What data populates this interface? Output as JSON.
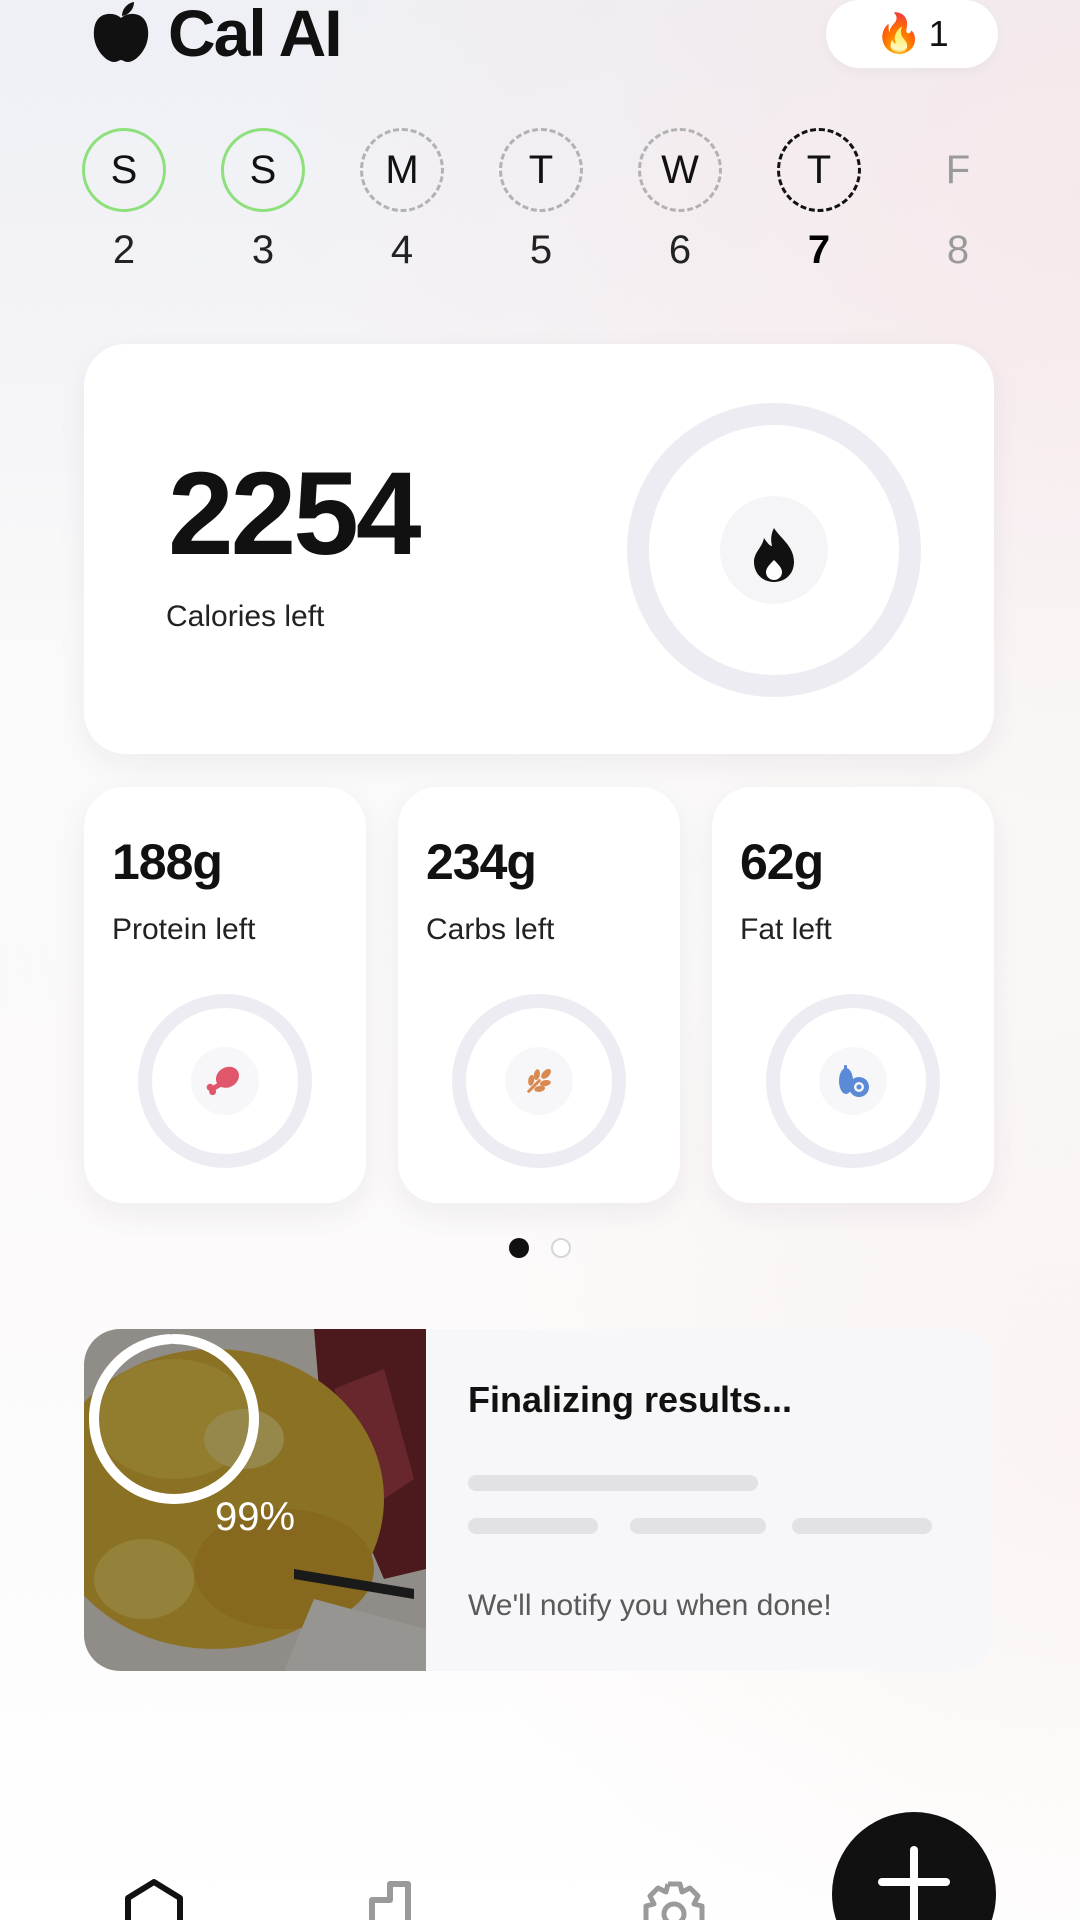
{
  "app": {
    "title": "Cal AI",
    "streak_count": "1"
  },
  "week": [
    {
      "letter": "S",
      "date": "2",
      "state": "done"
    },
    {
      "letter": "S",
      "date": "3",
      "state": "done"
    },
    {
      "letter": "M",
      "date": "4",
      "state": "missed"
    },
    {
      "letter": "T",
      "date": "5",
      "state": "missed"
    },
    {
      "letter": "W",
      "date": "6",
      "state": "missed"
    },
    {
      "letter": "T",
      "date": "7",
      "state": "today"
    },
    {
      "letter": "F",
      "date": "8",
      "state": "future"
    }
  ],
  "calories": {
    "value": "2254",
    "label": "Calories left",
    "progress": 0
  },
  "macros": [
    {
      "value": "188g",
      "label": "Protein left",
      "icon": "drumstick-icon",
      "color": "#e0566a",
      "progress": 0
    },
    {
      "value": "234g",
      "label": "Carbs left",
      "icon": "wheat-icon",
      "color": "#d98a52",
      "progress": 0
    },
    {
      "value": "62g",
      "label": "Fat left",
      "icon": "avocado-icon",
      "color": "#5b8ad6",
      "progress": 0
    }
  ],
  "pager": {
    "pages": 2,
    "active": 0
  },
  "scan": {
    "percent": "99%",
    "progress": 0.99,
    "title": "Finalizing results...",
    "note": "We'll notify you when done!"
  },
  "colors": {
    "done_ring": "#8ee07c",
    "accent": "#111111",
    "ring_track": "#ececf2"
  }
}
